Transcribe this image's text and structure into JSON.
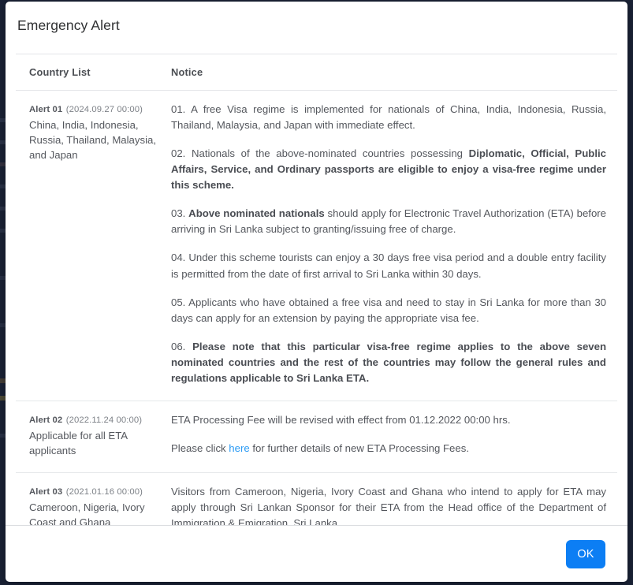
{
  "backdrop": {
    "color": "#1a2236"
  },
  "modal": {
    "title": "Emergency Alert",
    "columns": {
      "country_list": "Country List",
      "notice": "Notice"
    },
    "alerts": [
      {
        "id": "Alert 01",
        "date": "(2024.09.27 00:00)",
        "countries": "China, India, Indonesia, Russia, Thailand, Malaysia, and Japan",
        "notice_html": "<p class=\"notice-p\">01. A free Visa regime is implemented for nationals of China, India, Indonesia, Russia, Thailand, Malaysia, and Japan with immediate effect.</p><p class=\"notice-p\">02. Nationals of the above-nominated countries possessing <b>Diplomatic, Official, Public Affairs, Service, and Ordinary passports are eligible to enjoy a visa-free regime under this scheme.</b></p><p class=\"notice-p\">03. <b>Above nominated nationals</b> should apply for Electronic Travel Authorization (ETA) before arriving in Sri Lanka subject to granting/issuing free of charge.</p><p class=\"notice-p\">04. Under this scheme tourists can enjoy a 30 days free visa period and a double entry facility is permitted from the date of first arrival to Sri Lanka within 30 days.</p><p class=\"notice-p\">05. Applicants who have obtained a free visa and need to stay in Sri Lanka for more than 30 days can apply for an extension by paying the appropriate visa fee.</p><p class=\"notice-p\">06. <b>Please note that this particular visa-free regime applies to the above seven nominated countries and the rest of the countries may follow the general rules and regulations applicable to Sri Lanka ETA.</b></p>"
      },
      {
        "id": "Alert 02",
        "date": "(2022.11.24 00:00)",
        "countries": "Applicable for all ETA applicants",
        "notice_html": "<p class=\"notice-p nojustify\">ETA Processing Fee will be revised with effect from 01.12.2022 00:00 hrs.</p><p class=\"notice-p nojustify\">Please click <a href=\"#\" data-name=\"here-link\" data-interactable=\"true\">here</a> for further details of new ETA Processing Fees.</p>"
      },
      {
        "id": "Alert 03",
        "date": "(2021.01.16 00:00)",
        "countries": "Cameroon, Nigeria, Ivory Coast and Ghana",
        "notice_html": "<p class=\"notice-p\">Visitors from Cameroon, Nigeria, Ivory Coast and Ghana who intend to apply for ETA may apply through Sri Lankan Sponsor for their ETA from the Head office of the Department of Immigration &amp; Emigration, Sri Lanka.</p>"
      }
    ],
    "footer": {
      "ok_label": "OK",
      "ok_color": "#0c7ef4"
    }
  }
}
